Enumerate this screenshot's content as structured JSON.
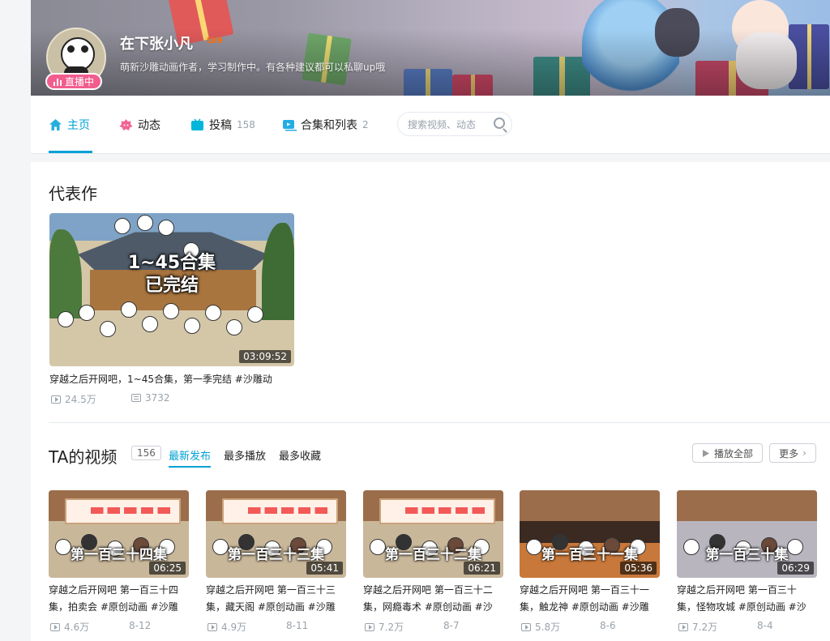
{
  "profile": {
    "name": "在下张小凡",
    "level": "LV6",
    "signature": "萌新沙雕动画作者，学习制作中。有各种建议都可以私聊up哦",
    "live_label": "直播中"
  },
  "nav": {
    "items": [
      {
        "label": "主页",
        "count": "",
        "icon": "home-icon"
      },
      {
        "label": "动态",
        "count": "",
        "icon": "dynamic-icon"
      },
      {
        "label": "投稿",
        "count": "158",
        "icon": "upload-icon"
      },
      {
        "label": "合集和列表",
        "count": "2",
        "icon": "collection-icon"
      }
    ],
    "search_placeholder": "搜索视频、动态"
  },
  "representative": {
    "section_title": "代表作",
    "title": "穿越之后开网吧，1~45合集，第一季完结 #沙雕动",
    "overlay_text_line1": "1~45合集",
    "overlay_text_line2": "已完结",
    "duration": "03:09:52",
    "plays": "24.5万",
    "danmaku": "3732"
  },
  "videos_section": {
    "title": "TA的视频",
    "count": "156",
    "tabs": [
      "最新发布",
      "最多播放",
      "最多收藏"
    ],
    "play_all_label": "播放全部",
    "more_label": "更多"
  },
  "videos": [
    {
      "title_line1": "穿越之后开网吧 第一百三十四",
      "title_line2": "集，拍卖会 #原创动画 #沙雕",
      "episode": "第一百三十四集",
      "duration": "06:25",
      "plays": "4.6万",
      "date": "8-12"
    },
    {
      "title_line1": "穿越之后开网吧 第一百三十三",
      "title_line2": "集，藏天阁 #原创动画 #沙雕",
      "episode": "第一百三十三集",
      "duration": "05:41",
      "plays": "4.9万",
      "date": "8-11"
    },
    {
      "title_line1": "穿越之后开网吧 第一百三十二",
      "title_line2": "集，网瘾毒术 #原创动画 #沙",
      "episode": "第一百三十二集",
      "duration": "06:21",
      "plays": "7.2万",
      "date": "8-7"
    },
    {
      "title_line1": "穿越之后开网吧 第一百三十一",
      "title_line2": "集，触龙神 #原创动画 #沙雕",
      "episode": "第一百三十一集",
      "duration": "05:36",
      "plays": "5.8万",
      "date": "8-6"
    },
    {
      "title_line1": "穿越之后开网吧 第一百三十",
      "title_line2": "集，怪物攻城 #原创动画 #沙",
      "episode": "第一百三十集",
      "duration": "06:29",
      "plays": "7.2万",
      "date": "8-4"
    }
  ],
  "colors": {
    "accent": "#00a1d6",
    "live": "#f25d8e",
    "level": "#ff6c00"
  }
}
